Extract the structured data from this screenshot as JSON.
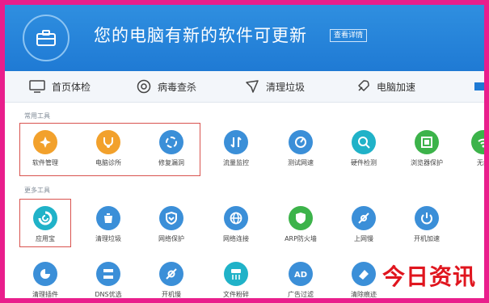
{
  "header": {
    "title": "您的电脑有新的软件可更新",
    "detail_button": "查看详情"
  },
  "nav": [
    {
      "label": "首页体检",
      "icon": "monitor-icon"
    },
    {
      "label": "病毒查杀",
      "icon": "virus-scan-icon"
    },
    {
      "label": "清理垃圾",
      "icon": "broom-icon"
    },
    {
      "label": "电脑加速",
      "icon": "rocket-icon"
    }
  ],
  "sections": {
    "common": "常用工具",
    "recommended": "更多工具"
  },
  "row1": [
    {
      "label": "软件管理",
      "icon": "software-manager-icon",
      "color": "#f2a12c"
    },
    {
      "label": "电脑诊所",
      "icon": "stethoscope-icon",
      "color": "#f2a12c"
    },
    {
      "label": "修复漏洞",
      "icon": "repair-icon",
      "color": "#3b8fd8"
    },
    {
      "label": "流量监控",
      "icon": "traffic-monitor-icon",
      "color": "#3b8fd8"
    },
    {
      "label": "测试网速",
      "icon": "speed-test-icon",
      "color": "#3b8fd8"
    },
    {
      "label": "硬件检测",
      "icon": "hardware-check-icon",
      "color": "#20b2c8"
    },
    {
      "label": "浏览器保护",
      "icon": "browser-shield-icon",
      "color": "#3cb34a"
    },
    {
      "label": "无线",
      "icon": "wifi-icon",
      "color": "#3cb34a"
    }
  ],
  "row2": [
    {
      "label": "应用宝",
      "icon": "app-store-icon",
      "color": "#20b2c8"
    },
    {
      "label": "清理垃圾",
      "icon": "cleanup-icon",
      "color": "#3b8fd8"
    },
    {
      "label": "网络保护",
      "icon": "network-shield-icon",
      "color": "#3b8fd8"
    },
    {
      "label": "网络连接",
      "icon": "globe-icon",
      "color": "#3b8fd8"
    },
    {
      "label": "ARP防火墙",
      "icon": "arp-firewall-icon",
      "color": "#3cb34a"
    },
    {
      "label": "上网慢",
      "icon": "slow-network-icon",
      "color": "#3b8fd8"
    },
    {
      "label": "开机加速",
      "icon": "boot-speed-icon",
      "color": "#3b8fd8"
    }
  ],
  "row3": [
    {
      "label": "清理插件",
      "icon": "plugin-clean-icon",
      "color": "#3b8fd8"
    },
    {
      "label": "DNS优选",
      "icon": "dns-icon",
      "color": "#3b8fd8"
    },
    {
      "label": "开机慢",
      "icon": "slow-boot-icon",
      "color": "#3b8fd8"
    },
    {
      "label": "文件粉碎",
      "icon": "file-shredder-icon",
      "color": "#20b2c8"
    },
    {
      "label": "广告过滤",
      "icon": "ad-filter-icon",
      "color": "#3b8fd8"
    },
    {
      "label": "清除痕迹",
      "icon": "erase-traces-icon",
      "color": "#3b8fd8"
    }
  ],
  "watermark": "今日资讯"
}
